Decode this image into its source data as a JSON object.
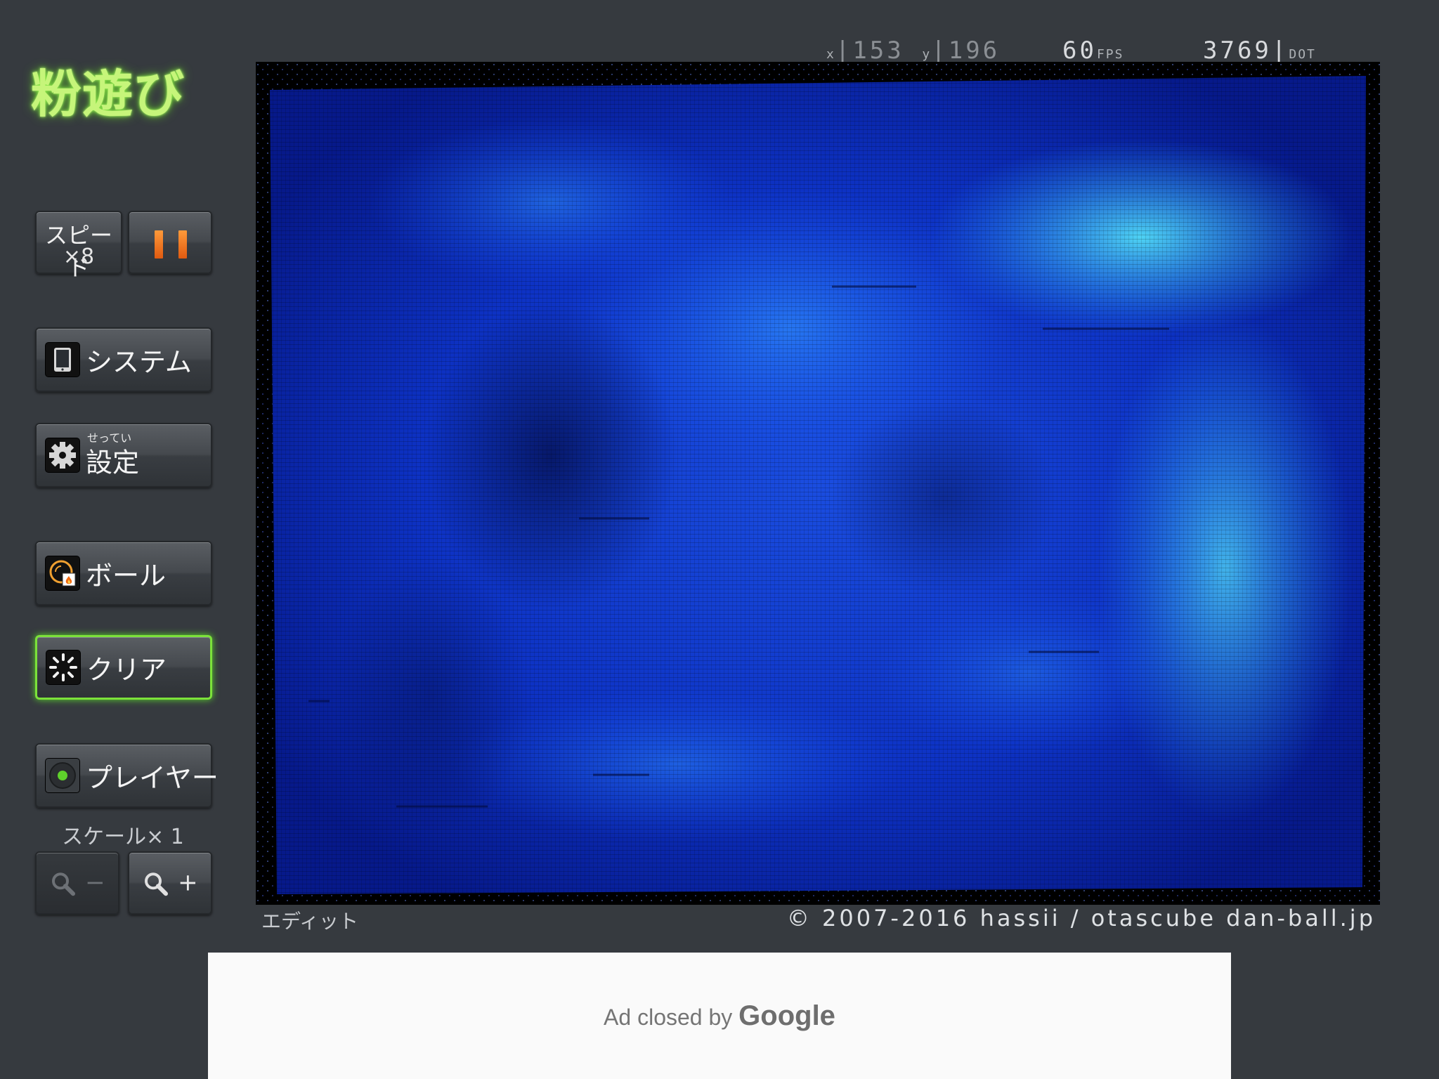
{
  "logo": "粉遊び",
  "speed": {
    "label": "スピード",
    "multiplier": "×8"
  },
  "menu": {
    "system": "システム",
    "settings_furigana": "せってい",
    "settings": "設定",
    "ball": "ボール",
    "clear": "クリア",
    "player": "プレイヤー"
  },
  "scale_label": "スケール× 1",
  "zoom": {
    "out": "−",
    "in": "+"
  },
  "hud": {
    "x_label": "x",
    "x_value": "153",
    "y_label": "y",
    "y_value": "196",
    "fps_value": "60",
    "fps_unit": "FPS",
    "dot_value": "3769",
    "dot_unit": "DOT"
  },
  "edit_label": "エディット",
  "copyright": "© 2007-2016 hassii / otascube  dan-ball.jp",
  "ad": {
    "text": "Ad closed by",
    "brand": "Google"
  },
  "colors": {
    "background": "#363a3f",
    "logo": "#c6f57a",
    "accent_active": "#7ce23a",
    "pause": "#f07a20",
    "simulation_deep": "#0a2fb8",
    "simulation_bright": "#3fe0f0"
  }
}
